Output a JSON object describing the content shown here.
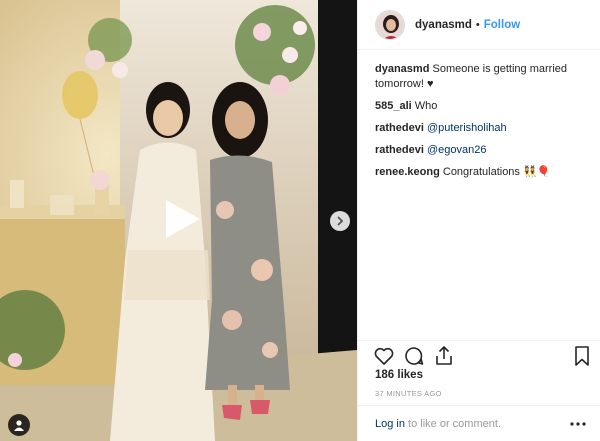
{
  "post": {
    "username": "dyanasmd",
    "follow_label": "Follow",
    "separator": "•"
  },
  "comments": [
    {
      "user": "dyanasmd",
      "text": "Someone is getting married tomorrow! ♥"
    },
    {
      "user": "585_ali",
      "text": "Who"
    },
    {
      "user": "rathedevi",
      "mention": "@puterisholihah"
    },
    {
      "user": "rathedevi",
      "mention": "@egovan26"
    },
    {
      "user": "renee.keong",
      "text": "Congratulations 👯🎈"
    }
  ],
  "likes": "186 likes",
  "time_ago": "37 MINUTES AGO",
  "footer": {
    "login_label": "Log in",
    "rest": " to like or comment."
  },
  "icons": {
    "like": "heart-icon",
    "comment": "comment-icon",
    "share": "share-icon",
    "save": "bookmark-icon",
    "more": "more-icon",
    "play": "play-icon",
    "next": "chevron-right-icon",
    "user_tag": "user-tag-icon"
  },
  "colors": {
    "link_blue": "#3897f0",
    "mention_blue": "#003569",
    "muted": "#999999",
    "text": "#262626"
  }
}
